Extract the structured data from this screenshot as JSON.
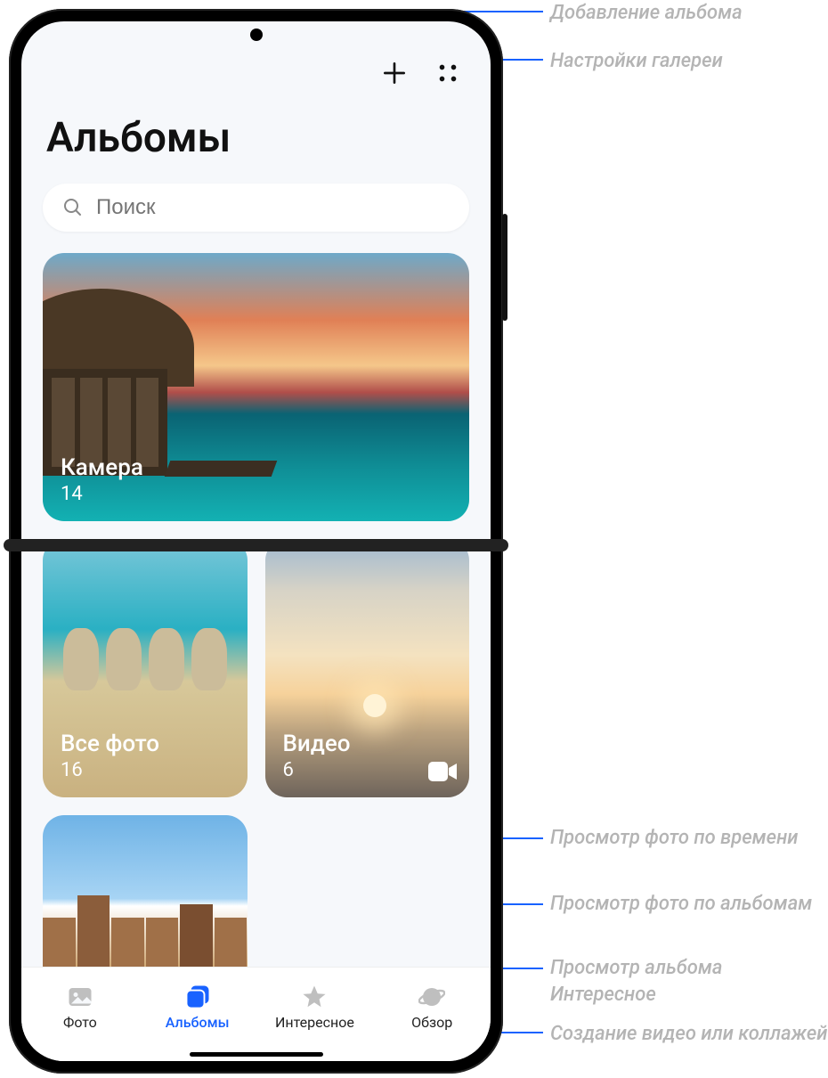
{
  "header": {
    "title": "Альбомы"
  },
  "search": {
    "placeholder": "Поиск"
  },
  "albums": {
    "camera": {
      "name": "Камера",
      "count": "14"
    },
    "all_photos": {
      "name": "Все фото",
      "count": "16"
    },
    "video": {
      "name": "Видео",
      "count": "6"
    }
  },
  "nav": {
    "photos": "Фото",
    "albums": "Альбомы",
    "highlights": "Интересное",
    "discover": "Обзор"
  },
  "callouts": {
    "add_album": "Добавление альбома",
    "settings": "Настройки галереи",
    "by_time": "Просмотр фото по времени",
    "by_albums": "Просмотр фото по альбомам",
    "highlights": "Просмотр альбома Интересное",
    "discover": "Создание видео или коллажей"
  }
}
